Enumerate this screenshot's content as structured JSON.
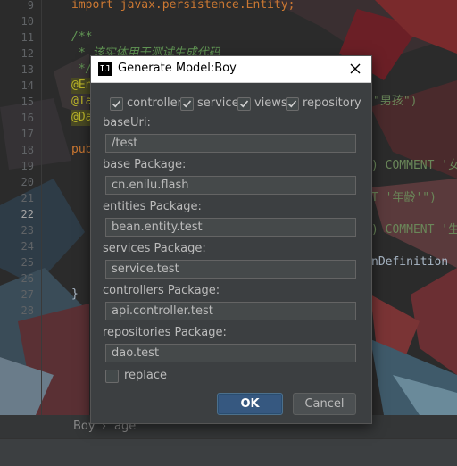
{
  "colors": {
    "accent": "#365880",
    "dialog_bg": "#3c3f41",
    "field_bg": "#45494a",
    "text": "#bbbbbb"
  },
  "editor": {
    "line_numbers": [
      "9",
      "10",
      "11",
      "12",
      "13",
      "14",
      "15",
      "16",
      "17",
      "18",
      "19",
      "20",
      "21",
      "22",
      "23",
      "24",
      "25",
      "26",
      "27",
      "28"
    ],
    "current_line": "22",
    "line9": "import javax.persistence.Entity;",
    "line11": "/**",
    "line12": " * 该实体用于测试生成代码",
    "line13": " */",
    "frag_ann1": "@En",
    "frag_ann2": "@Ta",
    "frag_ann3": "@Da",
    "frag_pub": "pub",
    "frag_brace": "}",
    "frag15": "\"男孩\")",
    "frag19": ") COMMENT '女",
    "frag20": "T '年龄'\")",
    "frag23": ") COMMENT '生",
    "frag25": "nDefinition"
  },
  "statusbar": {
    "crumb1": "Boy",
    "separator": "›",
    "crumb2": "age"
  },
  "dialog": {
    "title": "Generate Model:Boy",
    "app_icon": "IJ",
    "checkboxes": {
      "controller": {
        "label": "controller",
        "checked": true
      },
      "service": {
        "label": "service",
        "checked": true
      },
      "views": {
        "label": "views",
        "checked": true
      },
      "repository": {
        "label": "repository",
        "checked": true
      },
      "replace": {
        "label": "replace",
        "checked": false
      }
    },
    "fields": {
      "base_uri": {
        "label": "baseUri:",
        "value": "/test"
      },
      "base_package": {
        "label": "base Package:",
        "value": "cn.enilu.flash"
      },
      "entities_package": {
        "label": "entities Package:",
        "value": "bean.entity.test"
      },
      "services_package": {
        "label": "services Package:",
        "value": "service.test"
      },
      "controllers_package": {
        "label": "controllers Package:",
        "value": "api.controller.test"
      },
      "repositories_package": {
        "label": "repositories Package:",
        "value": "dao.test"
      }
    },
    "ok_label": "OK",
    "cancel_label": "Cancel"
  }
}
